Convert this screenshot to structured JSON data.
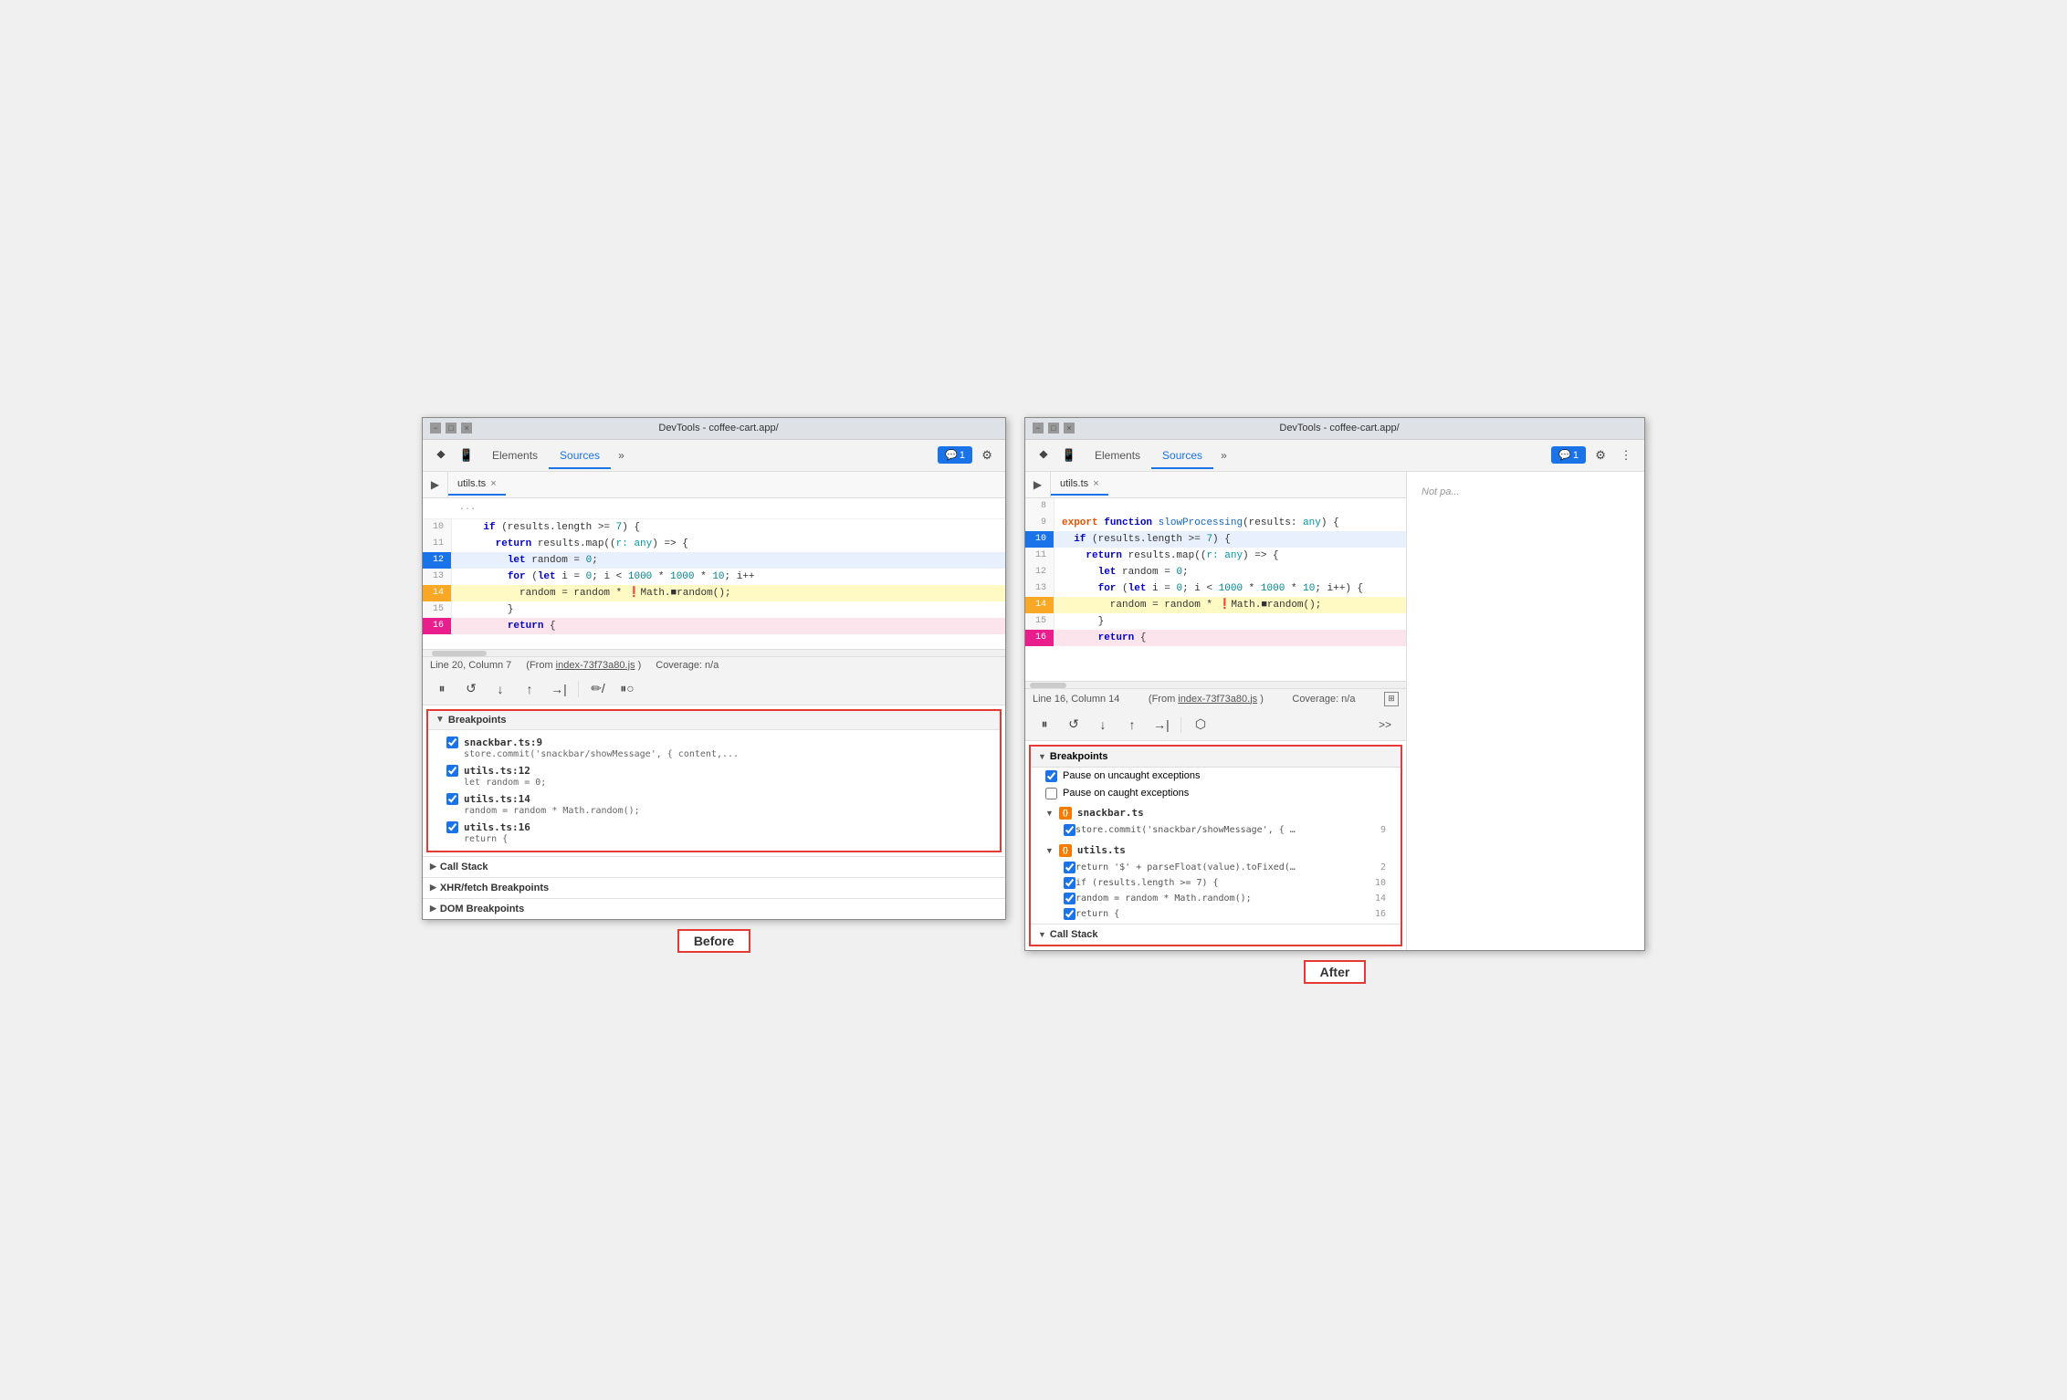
{
  "before_panel": {
    "title_bar": {
      "title": "DevTools - coffee-cart.app/",
      "minimize": "−",
      "maximize": "□",
      "close": "×"
    },
    "toolbar": {
      "elements_tab": "Elements",
      "sources_tab": "Sources",
      "more_tabs": "»",
      "notification_count": "1",
      "settings_icon": "⚙"
    },
    "file_tab": "utils.ts",
    "code_lines": [
      {
        "num": "10",
        "content": "    if (results.length >= 7) {",
        "state": ""
      },
      {
        "num": "11",
        "content": "      return results.map((r: any) => {",
        "state": ""
      },
      {
        "num": "12",
        "content": "        let random = 0;",
        "state": "active"
      },
      {
        "num": "13",
        "content": "        for (let i = 0; i < 1000 * 1000 * 10; i++",
        "state": ""
      },
      {
        "num": "14",
        "content": "          random = random * ❗Math.■random();",
        "state": "bp-yellow"
      },
      {
        "num": "15",
        "content": "        }",
        "state": ""
      },
      {
        "num": "16",
        "content": "        return {",
        "state": "bp-pink"
      }
    ],
    "status": {
      "position": "Line 20, Column 7",
      "source": "(From index-73f73a80.js)",
      "source_link": "index-73f73a80.js",
      "coverage": "Coverage: n/a"
    },
    "debug_buttons": [
      "⏸",
      "↺",
      "↓",
      "↑",
      "→|",
      "✏/",
      "⏸○"
    ],
    "breakpoints_section": {
      "title": "Breakpoints",
      "items": [
        {
          "checked": true,
          "filename": "snackbar.ts:9",
          "code": "store.commit('snackbar/showMessage', { content,..."
        },
        {
          "checked": true,
          "filename": "utils.ts:12",
          "code": "let random = 0;"
        },
        {
          "checked": true,
          "filename": "utils.ts:14",
          "code": "random = random * Math.random();"
        },
        {
          "checked": true,
          "filename": "utils.ts:16",
          "code": "return {"
        }
      ]
    },
    "call_stack": "Call Stack",
    "xhr_breakpoints": "XHR/fetch Breakpoints",
    "dom_breakpoints": "DOM Breakpoints"
  },
  "after_panel": {
    "title_bar": {
      "title": "DevTools - coffee-cart.app/",
      "minimize": "−",
      "maximize": "□",
      "close": "×"
    },
    "toolbar": {
      "elements_tab": "Elements",
      "sources_tab": "Sources",
      "more_tabs": "»",
      "notification_count": "1",
      "settings_icon": "⚙",
      "three_dots": "⋮"
    },
    "file_tab": "utils.ts",
    "code_lines": [
      {
        "num": "8",
        "content": "",
        "state": ""
      },
      {
        "num": "9",
        "content": "export function slowProcessing(results: any) {",
        "state": ""
      },
      {
        "num": "10",
        "content": "  if (results.length >= 7) {",
        "state": "active"
      },
      {
        "num": "11",
        "content": "    return results.map((r: any) => {",
        "state": ""
      },
      {
        "num": "12",
        "content": "      let random = 0;",
        "state": ""
      },
      {
        "num": "13",
        "content": "      for (let i = 0; i < 1000 * 1000 * 10; i++) {",
        "state": ""
      },
      {
        "num": "14",
        "content": "        random = random * ❗Math.■random();",
        "state": "bp-yellow"
      },
      {
        "num": "15",
        "content": "      }",
        "state": ""
      },
      {
        "num": "16",
        "content": "      return {",
        "state": "bp-pink"
      }
    ],
    "status": {
      "position": "Line 16, Column 14",
      "source": "(From index-73f73a80.js)",
      "source_link": "index-73f73a80.js",
      "coverage": "Coverage: n/a"
    },
    "debug_buttons": [
      "⏸",
      "↺",
      "↓",
      "↑",
      "→|",
      "⬡"
    ],
    "breakpoints_section": {
      "title": "Breakpoints",
      "pause_uncaught": "Pause on uncaught exceptions",
      "pause_caught": "Pause on caught exceptions",
      "files": [
        {
          "name": "snackbar.ts",
          "items": [
            {
              "checked": true,
              "code": "store.commit('snackbar/showMessage', { …",
              "line": "9"
            }
          ]
        },
        {
          "name": "utils.ts",
          "items": [
            {
              "checked": true,
              "code": "return '$' + parseFloat(value).toFixed(…",
              "line": "2"
            },
            {
              "checked": true,
              "code": "if (results.length >= 7) {",
              "line": "10"
            },
            {
              "checked": true,
              "code": "random = random * Math.random();",
              "line": "14"
            },
            {
              "checked": true,
              "code": "return {",
              "line": "16"
            }
          ]
        }
      ]
    },
    "call_stack": "Call Stack",
    "not_paused": "Not pa..."
  },
  "labels": {
    "before": "Before",
    "after": "After"
  }
}
